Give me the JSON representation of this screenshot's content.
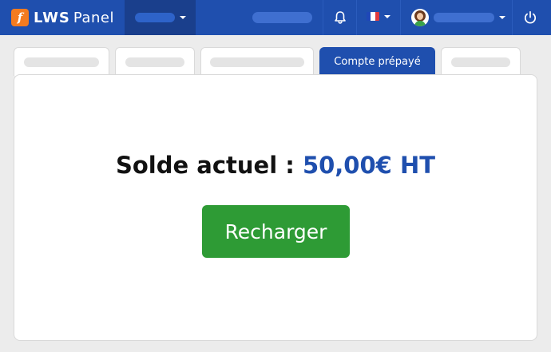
{
  "app": {
    "brand": "LWS",
    "product": "Panel",
    "logo_glyph": "f"
  },
  "colors": {
    "navbar": "#1f4fae",
    "accent_blue": "#1f4fae",
    "logo_orange": "#f47b20",
    "button_green": "#2e9b35"
  },
  "icons": {
    "notifications": "bell-icon",
    "language": "french-flag-icon",
    "user": "user-avatar-icon",
    "logout": "power-icon"
  },
  "tabs": [
    {
      "label": ""
    },
    {
      "label": ""
    },
    {
      "label": ""
    },
    {
      "label": "Compte prépayé",
      "active": true
    },
    {
      "label": ""
    }
  ],
  "balance": {
    "label": "Solde actuel :",
    "amount": "50,00€ HT"
  },
  "actions": {
    "recharge_label": "Recharger"
  }
}
